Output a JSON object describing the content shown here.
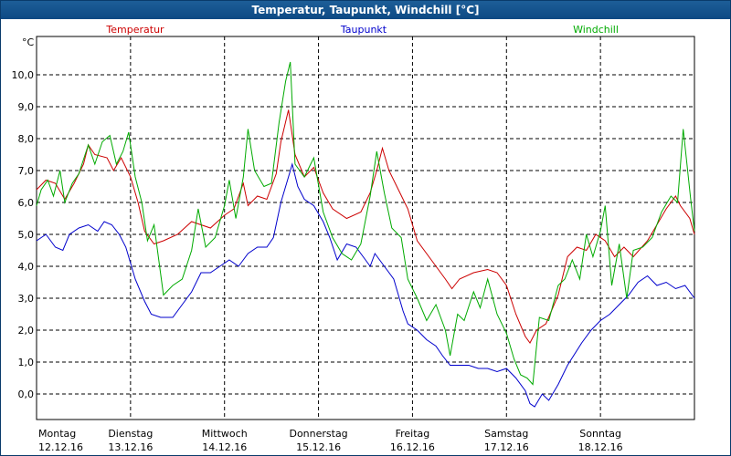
{
  "window": {
    "title": "Temperatur, Taupunkt, Windchill [°C]"
  },
  "chart_data": {
    "type": "line",
    "title": "Temperatur, Taupunkt, Windchill [°C]",
    "ylabel": "°C",
    "ylim": [
      -0.8,
      11.2
    ],
    "yticks": [
      0,
      1,
      2,
      3,
      4,
      5,
      6,
      7,
      8,
      9,
      10
    ],
    "ytick_labels": [
      "0,0",
      "1,0",
      "2,0",
      "3,0",
      "4,0",
      "5,0",
      "6,0",
      "7,0",
      "8,0",
      "9,0",
      "10,0"
    ],
    "xlim": [
      0,
      7
    ],
    "x_categories": [
      {
        "day": "Montag",
        "date": "12.12.16"
      },
      {
        "day": "Dienstag",
        "date": "13.12.16"
      },
      {
        "day": "Mittwoch",
        "date": "14.12.16"
      },
      {
        "day": "Donnerstag",
        "date": "15.12.16"
      },
      {
        "day": "Freitag",
        "date": "16.12.16"
      },
      {
        "day": "Samstag",
        "date": "17.12.16"
      },
      {
        "day": "Sonntag",
        "date": "18.12.16"
      }
    ],
    "grid": true,
    "legend_position": "top",
    "series": [
      {
        "name": "Temperatur",
        "color": "#cc0000",
        "points": [
          [
            0,
            6.4
          ],
          [
            0.1,
            6.7
          ],
          [
            0.2,
            6.6
          ],
          [
            0.3,
            6.1
          ],
          [
            0.4,
            6.6
          ],
          [
            0.5,
            7.2
          ],
          [
            0.55,
            7.8
          ],
          [
            0.62,
            7.5
          ],
          [
            0.75,
            7.4
          ],
          [
            0.82,
            7.0
          ],
          [
            0.9,
            7.4
          ],
          [
            1.0,
            6.8
          ],
          [
            1.08,
            6.0
          ],
          [
            1.15,
            5.1
          ],
          [
            1.25,
            4.7
          ],
          [
            1.35,
            4.8
          ],
          [
            1.5,
            5.0
          ],
          [
            1.65,
            5.4
          ],
          [
            1.85,
            5.2
          ],
          [
            2.0,
            5.6
          ],
          [
            2.1,
            5.8
          ],
          [
            2.2,
            6.6
          ],
          [
            2.25,
            5.9
          ],
          [
            2.35,
            6.2
          ],
          [
            2.45,
            6.1
          ],
          [
            2.55,
            6.9
          ],
          [
            2.6,
            7.9
          ],
          [
            2.68,
            8.9
          ],
          [
            2.75,
            7.5
          ],
          [
            2.85,
            6.8
          ],
          [
            2.95,
            7.1
          ],
          [
            3.05,
            6.3
          ],
          [
            3.15,
            5.8
          ],
          [
            3.3,
            5.5
          ],
          [
            3.45,
            5.7
          ],
          [
            3.55,
            6.3
          ],
          [
            3.62,
            7.0
          ],
          [
            3.68,
            7.7
          ],
          [
            3.75,
            7.0
          ],
          [
            3.85,
            6.4
          ],
          [
            3.95,
            5.8
          ],
          [
            4.05,
            4.8
          ],
          [
            4.2,
            4.2
          ],
          [
            4.35,
            3.6
          ],
          [
            4.42,
            3.3
          ],
          [
            4.5,
            3.6
          ],
          [
            4.65,
            3.8
          ],
          [
            4.8,
            3.9
          ],
          [
            4.9,
            3.8
          ],
          [
            5.0,
            3.4
          ],
          [
            5.1,
            2.5
          ],
          [
            5.2,
            1.8
          ],
          [
            5.25,
            1.6
          ],
          [
            5.32,
            2.0
          ],
          [
            5.42,
            2.2
          ],
          [
            5.55,
            3.1
          ],
          [
            5.65,
            4.3
          ],
          [
            5.75,
            4.6
          ],
          [
            5.85,
            4.5
          ],
          [
            5.95,
            5.0
          ],
          [
            6.05,
            4.8
          ],
          [
            6.15,
            4.3
          ],
          [
            6.25,
            4.6
          ],
          [
            6.35,
            4.3
          ],
          [
            6.5,
            4.8
          ],
          [
            6.6,
            5.3
          ],
          [
            6.7,
            5.8
          ],
          [
            6.8,
            6.2
          ],
          [
            6.85,
            5.9
          ],
          [
            6.95,
            5.5
          ],
          [
            7.0,
            5.0
          ]
        ]
      },
      {
        "name": "Taupunkt",
        "color": "#0000cc",
        "points": [
          [
            0,
            4.8
          ],
          [
            0.1,
            5.0
          ],
          [
            0.2,
            4.6
          ],
          [
            0.28,
            4.5
          ],
          [
            0.35,
            5.0
          ],
          [
            0.45,
            5.2
          ],
          [
            0.55,
            5.3
          ],
          [
            0.65,
            5.1
          ],
          [
            0.72,
            5.4
          ],
          [
            0.8,
            5.3
          ],
          [
            0.88,
            5.0
          ],
          [
            0.95,
            4.6
          ],
          [
            1.05,
            3.6
          ],
          [
            1.15,
            2.9
          ],
          [
            1.22,
            2.5
          ],
          [
            1.32,
            2.4
          ],
          [
            1.45,
            2.4
          ],
          [
            1.55,
            2.8
          ],
          [
            1.65,
            3.2
          ],
          [
            1.75,
            3.8
          ],
          [
            1.85,
            3.8
          ],
          [
            1.95,
            4.0
          ],
          [
            2.05,
            4.2
          ],
          [
            2.15,
            4.0
          ],
          [
            2.25,
            4.4
          ],
          [
            2.35,
            4.6
          ],
          [
            2.45,
            4.6
          ],
          [
            2.52,
            4.9
          ],
          [
            2.6,
            6.0
          ],
          [
            2.68,
            6.8
          ],
          [
            2.72,
            7.2
          ],
          [
            2.78,
            6.5
          ],
          [
            2.85,
            6.1
          ],
          [
            2.95,
            5.9
          ],
          [
            3.05,
            5.4
          ],
          [
            3.12,
            4.9
          ],
          [
            3.2,
            4.2
          ],
          [
            3.3,
            4.7
          ],
          [
            3.4,
            4.6
          ],
          [
            3.5,
            4.2
          ],
          [
            3.55,
            4.0
          ],
          [
            3.6,
            4.4
          ],
          [
            3.7,
            4.0
          ],
          [
            3.8,
            3.6
          ],
          [
            3.9,
            2.6
          ],
          [
            3.95,
            2.2
          ],
          [
            4.05,
            2.0
          ],
          [
            4.15,
            1.7
          ],
          [
            4.25,
            1.5
          ],
          [
            4.32,
            1.2
          ],
          [
            4.4,
            0.9
          ],
          [
            4.5,
            0.9
          ],
          [
            4.6,
            0.9
          ],
          [
            4.7,
            0.8
          ],
          [
            4.8,
            0.8
          ],
          [
            4.9,
            0.7
          ],
          [
            5.0,
            0.8
          ],
          [
            5.1,
            0.5
          ],
          [
            5.2,
            0.1
          ],
          [
            5.25,
            -0.3
          ],
          [
            5.3,
            -0.4
          ],
          [
            5.38,
            0.0
          ],
          [
            5.45,
            -0.2
          ],
          [
            5.55,
            0.3
          ],
          [
            5.65,
            0.9
          ],
          [
            5.8,
            1.6
          ],
          [
            5.9,
            2.0
          ],
          [
            6.0,
            2.3
          ],
          [
            6.1,
            2.5
          ],
          [
            6.2,
            2.8
          ],
          [
            6.3,
            3.1
          ],
          [
            6.4,
            3.5
          ],
          [
            6.5,
            3.7
          ],
          [
            6.6,
            3.4
          ],
          [
            6.7,
            3.5
          ],
          [
            6.8,
            3.3
          ],
          [
            6.9,
            3.4
          ],
          [
            7.0,
            3.0
          ]
        ]
      },
      {
        "name": "Windchill",
        "color": "#00aa00",
        "points": [
          [
            0,
            5.9
          ],
          [
            0.05,
            6.4
          ],
          [
            0.12,
            6.7
          ],
          [
            0.18,
            6.2
          ],
          [
            0.25,
            7.0
          ],
          [
            0.3,
            6.0
          ],
          [
            0.38,
            6.6
          ],
          [
            0.45,
            6.9
          ],
          [
            0.55,
            7.8
          ],
          [
            0.62,
            7.2
          ],
          [
            0.7,
            7.9
          ],
          [
            0.78,
            8.1
          ],
          [
            0.85,
            7.2
          ],
          [
            0.92,
            7.6
          ],
          [
            0.98,
            8.2
          ],
          [
            1.05,
            6.8
          ],
          [
            1.12,
            6.0
          ],
          [
            1.18,
            4.8
          ],
          [
            1.25,
            5.3
          ],
          [
            1.35,
            3.1
          ],
          [
            1.45,
            3.4
          ],
          [
            1.55,
            3.6
          ],
          [
            1.65,
            4.5
          ],
          [
            1.72,
            5.8
          ],
          [
            1.8,
            4.6
          ],
          [
            1.9,
            4.9
          ],
          [
            2.0,
            5.9
          ],
          [
            2.05,
            6.7
          ],
          [
            2.12,
            5.5
          ],
          [
            2.2,
            6.8
          ],
          [
            2.25,
            8.3
          ],
          [
            2.32,
            7.0
          ],
          [
            2.42,
            6.5
          ],
          [
            2.5,
            6.6
          ],
          [
            2.58,
            8.5
          ],
          [
            2.65,
            9.8
          ],
          [
            2.7,
            10.4
          ],
          [
            2.75,
            7.2
          ],
          [
            2.85,
            6.8
          ],
          [
            2.95,
            7.4
          ],
          [
            3.05,
            5.7
          ],
          [
            3.15,
            4.9
          ],
          [
            3.25,
            4.4
          ],
          [
            3.35,
            4.2
          ],
          [
            3.45,
            4.7
          ],
          [
            3.55,
            6.2
          ],
          [
            3.62,
            7.6
          ],
          [
            3.7,
            6.3
          ],
          [
            3.78,
            5.2
          ],
          [
            3.88,
            4.9
          ],
          [
            3.95,
            3.6
          ],
          [
            4.05,
            3.0
          ],
          [
            4.15,
            2.3
          ],
          [
            4.25,
            2.8
          ],
          [
            4.35,
            2.0
          ],
          [
            4.4,
            1.2
          ],
          [
            4.48,
            2.5
          ],
          [
            4.55,
            2.3
          ],
          [
            4.65,
            3.2
          ],
          [
            4.72,
            2.7
          ],
          [
            4.8,
            3.6
          ],
          [
            4.9,
            2.5
          ],
          [
            5.0,
            1.9
          ],
          [
            5.08,
            1.1
          ],
          [
            5.15,
            0.6
          ],
          [
            5.22,
            0.5
          ],
          [
            5.28,
            0.3
          ],
          [
            5.35,
            2.4
          ],
          [
            5.45,
            2.3
          ],
          [
            5.55,
            3.4
          ],
          [
            5.62,
            3.6
          ],
          [
            5.7,
            4.2
          ],
          [
            5.78,
            3.6
          ],
          [
            5.85,
            5.0
          ],
          [
            5.92,
            4.3
          ],
          [
            6.0,
            5.1
          ],
          [
            6.05,
            5.9
          ],
          [
            6.12,
            3.4
          ],
          [
            6.2,
            4.7
          ],
          [
            6.28,
            3.0
          ],
          [
            6.35,
            4.5
          ],
          [
            6.45,
            4.6
          ],
          [
            6.55,
            4.9
          ],
          [
            6.65,
            5.7
          ],
          [
            6.75,
            6.2
          ],
          [
            6.82,
            6.0
          ],
          [
            6.88,
            8.3
          ],
          [
            6.92,
            7.2
          ],
          [
            6.96,
            6.1
          ],
          [
            7.0,
            5.1
          ]
        ]
      }
    ]
  }
}
